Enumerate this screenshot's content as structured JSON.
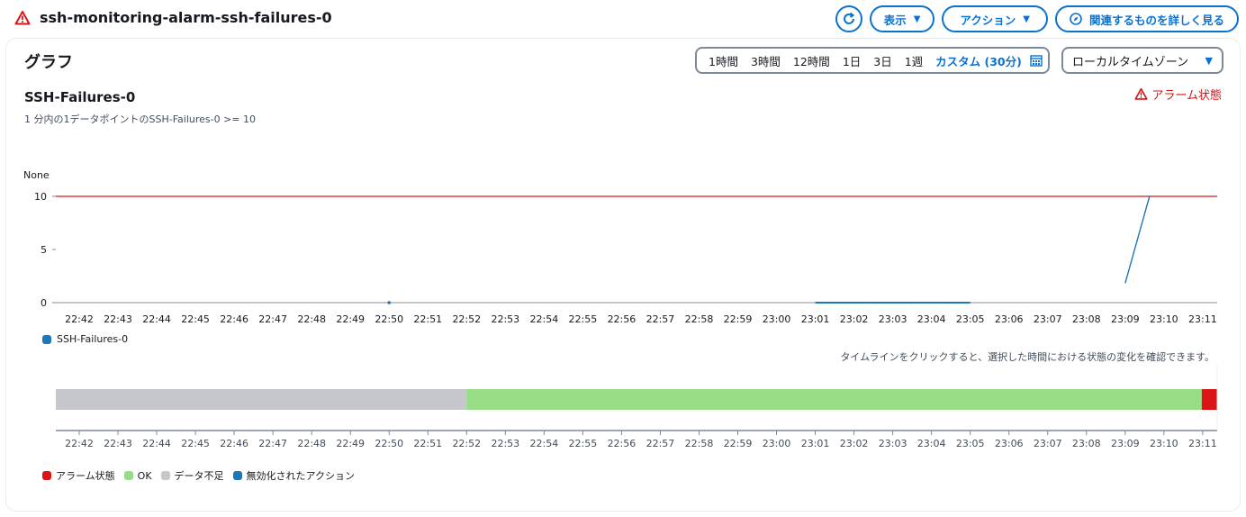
{
  "header": {
    "alarm_name": "ssh-monitoring-alarm-ssh-failures-0",
    "buttons": {
      "view": "表示",
      "actions": "アクション",
      "explore_related": "関連するものを詳しく見る"
    }
  },
  "panel": {
    "title": "グラフ",
    "time_ranges": [
      "1時間",
      "3時間",
      "12時間",
      "1日",
      "3日",
      "1週"
    ],
    "custom_range": "カスタム (30分)",
    "timezone": "ローカルタイムゾーン",
    "metric_title": "SSH-Failures-0",
    "metric_subtitle": "1 分内の1データポイントのSSH-Failures-0 >= 10",
    "alarm_state_label": "アラーム状態",
    "timeline_hint": "タイムラインをクリックすると、選択した時間における状態の変化を確認できます。"
  },
  "colors": {
    "accent": "#0972d3",
    "alarm": "#d91515",
    "ok": "#96dd85",
    "insufficient": "#c6c6cd",
    "series": "#1f77b4"
  },
  "chart_data": {
    "type": "line",
    "ylabel": "None",
    "ylim": [
      0,
      10
    ],
    "yticks": [
      "10",
      "5",
      "0"
    ],
    "x": [
      "22:42",
      "22:43",
      "22:44",
      "22:45",
      "22:46",
      "22:47",
      "22:48",
      "22:49",
      "22:50",
      "22:51",
      "22:52",
      "22:53",
      "22:54",
      "22:55",
      "22:56",
      "22:57",
      "22:58",
      "22:59",
      "23:00",
      "23:01",
      "23:02",
      "23:03",
      "23:04",
      "23:05",
      "23:06",
      "23:07",
      "23:08",
      "23:09",
      "23:10",
      "23:11"
    ],
    "threshold": 10,
    "series": [
      {
        "name": "SSH-Failures-0",
        "points": [
          {
            "x": "22:50",
            "y": 0
          },
          {
            "x": "23:01",
            "y": 0
          },
          {
            "x": "23:02",
            "y": 0
          },
          {
            "x": "23:03",
            "y": 0
          },
          {
            "x": "23:04",
            "y": 0
          },
          {
            "x": "23:05",
            "y": 0
          },
          {
            "x": "23:09",
            "y": 2
          },
          {
            "x": "23:10",
            "y": 10
          }
        ]
      }
    ]
  },
  "timeline": {
    "segments": [
      {
        "state": "insufficient",
        "from": "22:42",
        "to": "22:52"
      },
      {
        "state": "ok",
        "from": "22:52",
        "to": "23:11"
      },
      {
        "state": "alarm",
        "from": "23:11",
        "to": "end"
      }
    ],
    "legend": [
      {
        "label": "アラーム状態",
        "color": "#d91515"
      },
      {
        "label": "OK",
        "color": "#96dd85"
      },
      {
        "label": "データ不足",
        "color": "#c6c6cd"
      },
      {
        "label": "無効化されたアクション",
        "color": "#1f77b4"
      }
    ]
  }
}
